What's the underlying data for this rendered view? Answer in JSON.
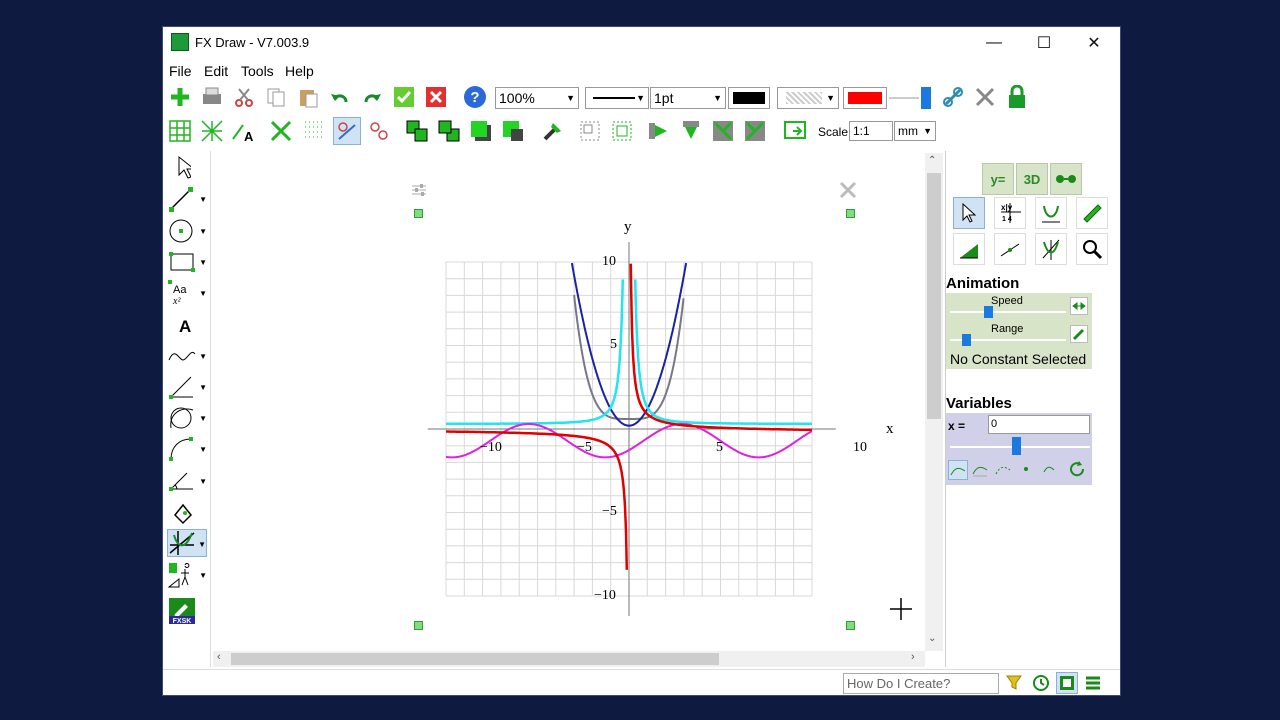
{
  "window": {
    "title": "FX Draw - V7.003.9"
  },
  "menu": [
    "File",
    "Edit",
    "Tools",
    "Help"
  ],
  "toolbar": {
    "zoom": "100%",
    "line_width": "1pt",
    "scale_label": "Scale",
    "scale_value": "1:1",
    "scale_unit": "mm"
  },
  "right_panel": {
    "buttons_top": [
      "y=",
      "3D"
    ],
    "animation": {
      "heading": "Animation",
      "speed_label": "Speed",
      "range_label": "Range",
      "status": "No Constant Selected"
    },
    "variables": {
      "heading": "Variables",
      "var_label": "x =",
      "var_value": "0"
    }
  },
  "graph": {
    "x_axis_label": "x",
    "y_axis_label": "y",
    "x_ticks": [
      "−10",
      "−5",
      "5",
      "10"
    ],
    "y_ticks": [
      "10",
      "5",
      "−5",
      "−10"
    ]
  },
  "status": {
    "search_placeholder": "How Do I Create?"
  },
  "colors": {
    "accent_green": "#22b522",
    "red": "#e00000",
    "cyan": "#22e5f0",
    "navy": "#1a22a0",
    "gray": "#777788",
    "magenta": "#e020e0"
  }
}
